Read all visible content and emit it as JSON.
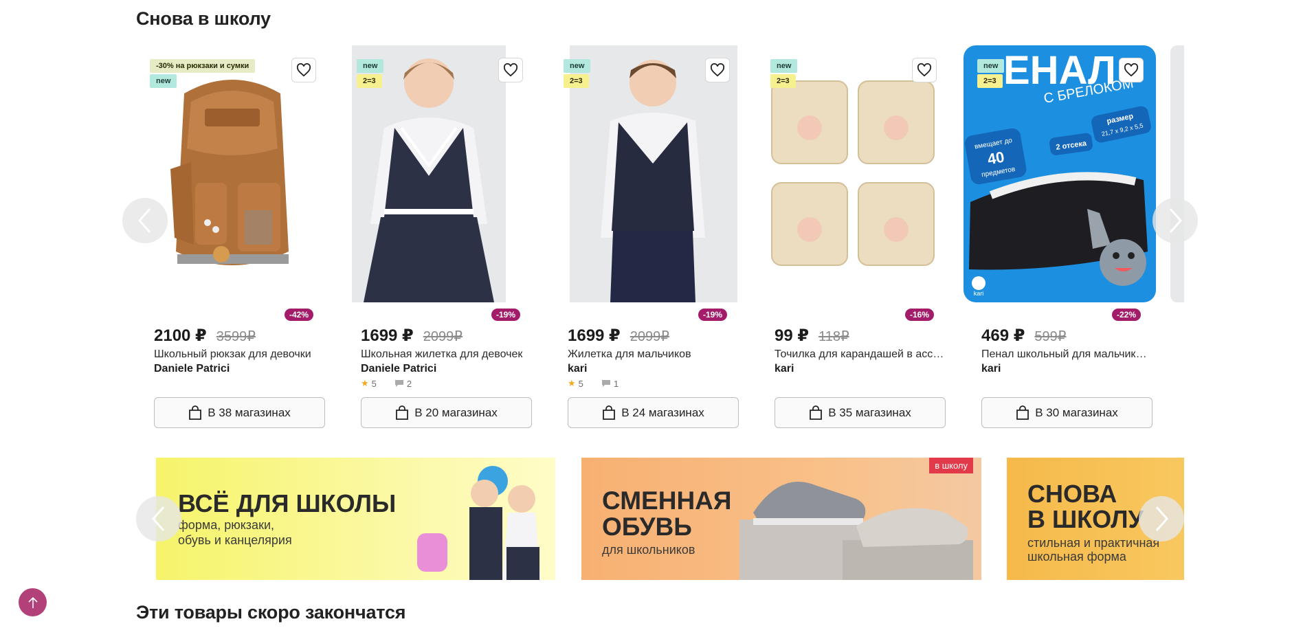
{
  "section1": {
    "title": "Снова в школу"
  },
  "section2": {
    "title": "Эти товары скоро закончатся"
  },
  "icons": {
    "favorite": "heart-icon",
    "stores": "shopping-bag-icon",
    "prev": "chevron-left-icon",
    "next": "chevron-right-icon",
    "up": "arrow-up-icon",
    "star": "star-icon",
    "comment": "comment-icon"
  },
  "colors": {
    "discount_badge": "#a21c6a",
    "new_badge": "#b3e8de",
    "promo_badge": "#f7f08e",
    "scroll_up": "#b2417a"
  },
  "products": [
    {
      "badges": [
        "-30% на рюкзаки и сумки",
        "new"
      ],
      "discount": "-42%",
      "price": "2100 ₽",
      "old_price": "3599₽",
      "name": "Школьный рюкзак для девочки",
      "brand": "Daniele Patrici",
      "rating": "",
      "reviews": "",
      "stores": "В 38 магазинах"
    },
    {
      "badges": [
        "new",
        "2=3"
      ],
      "discount": "-19%",
      "price": "1699 ₽",
      "old_price": "2099₽",
      "name": "Школьная жилетка для девочек",
      "brand": "Daniele Patrici",
      "rating": "5",
      "reviews": "2",
      "stores": "В 20 магазинах"
    },
    {
      "badges": [
        "new",
        "2=3"
      ],
      "discount": "-19%",
      "price": "1699 ₽",
      "old_price": "2099₽",
      "name": "Жилетка для мальчиков",
      "brand": "kari",
      "rating": "5",
      "reviews": "1",
      "stores": "В 24 магазинах"
    },
    {
      "badges": [
        "new",
        "2=3"
      ],
      "discount": "-16%",
      "price": "99 ₽",
      "old_price": "118₽",
      "name": "Точилка для карандашей в ассортименте",
      "brand": "kari",
      "rating": "",
      "reviews": "",
      "stores": "В 35 магазинах"
    },
    {
      "badges": [
        "new",
        "2=3"
      ],
      "discount": "-22%",
      "price": "469 ₽",
      "old_price": "599₽",
      "name": "Пенал школьный для мальчиков с брелоком",
      "brand": "kari",
      "rating": "",
      "reviews": "",
      "stores": "В 30 магазинах"
    }
  ],
  "banners": [
    {
      "title_line1": "ВСЁ ДЛЯ ШКОЛЫ",
      "subtitle_line1": "форма, рюкзаки,",
      "subtitle_line2": "обувь и канцелярия"
    },
    {
      "title_line1": "СМЕННАЯ",
      "title_line2": "ОБУВЬ",
      "subtitle_line1": "для школьников",
      "tag": "в школу"
    },
    {
      "title_line1": "СНОВА",
      "title_line2": "В ШКОЛУ",
      "subtitle_line1": "стильная и практичная",
      "subtitle_line2": "школьная форма"
    }
  ],
  "pencil_case_art": {
    "title": "ЕНАЛ",
    "subtitle": "С БРЕЛОКОМ",
    "size_label": "размер",
    "size_value": "21,7 x 9,2 x 5,5",
    "capacity_1": "вмещает до",
    "capacity_2": "40",
    "capacity_3": "предметов",
    "compartments": "2 отсека",
    "logo": "kari"
  }
}
